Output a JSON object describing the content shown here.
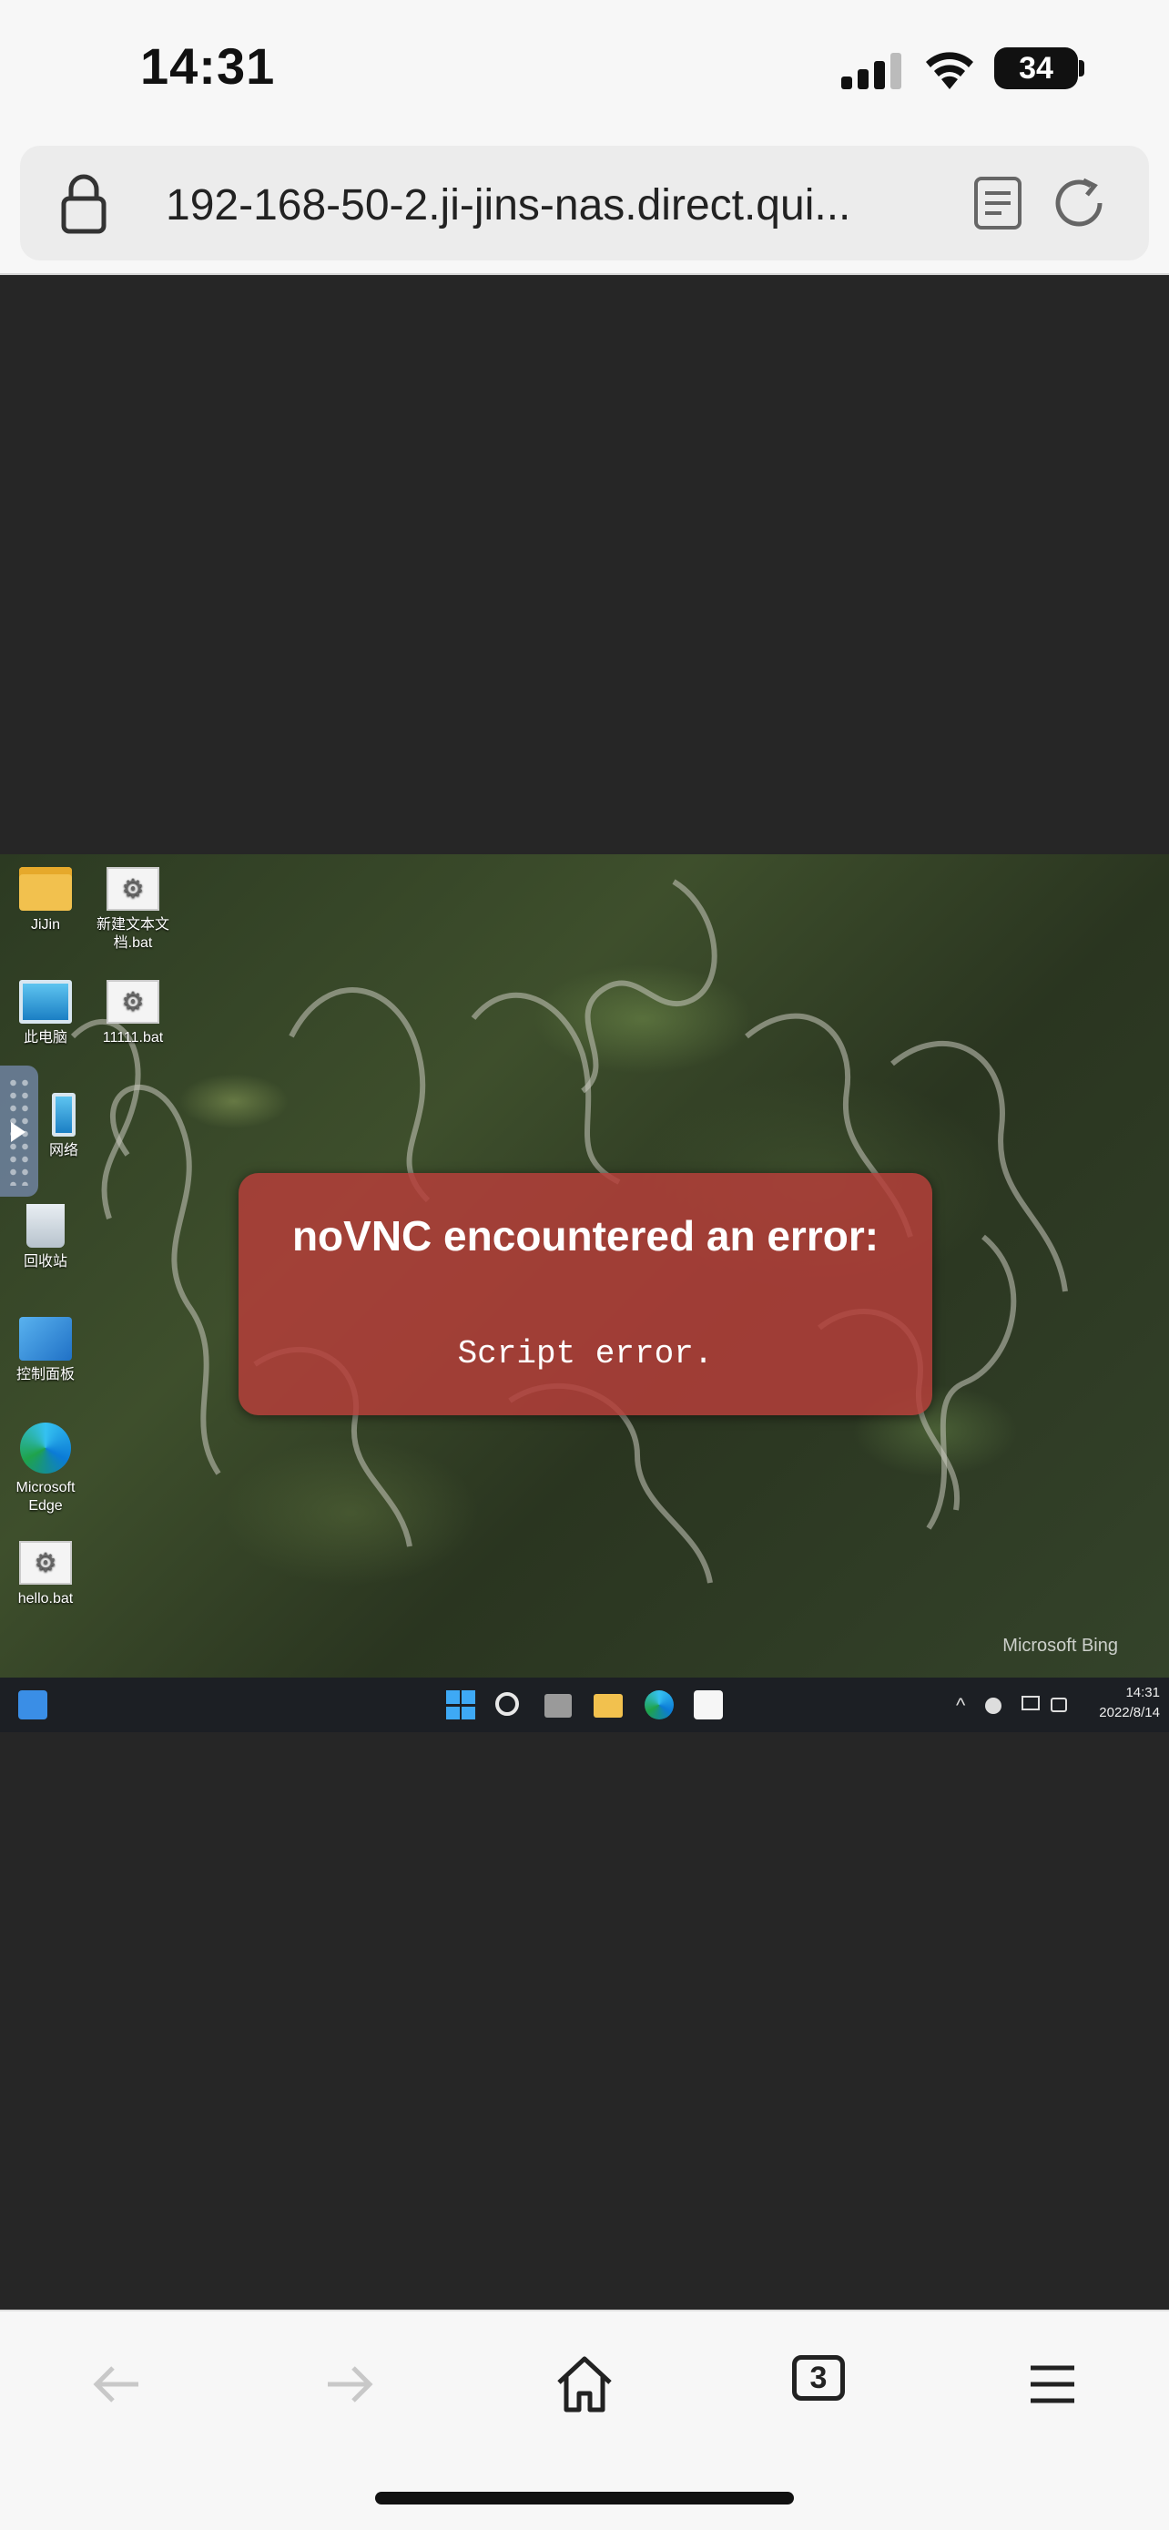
{
  "status_bar": {
    "time": "14:31",
    "battery": "34"
  },
  "browser": {
    "url": "192-168-50-2.ji-jins-nas.direct.qui...",
    "tabs_count": "3"
  },
  "desktop": {
    "icons": [
      {
        "label": "JiJin",
        "type": "folder"
      },
      {
        "label": "新建文本文档.bat",
        "type": "bat"
      },
      {
        "label": "此电脑",
        "type": "pc"
      },
      {
        "label": "11111.bat",
        "type": "bat"
      },
      {
        "label": "网络",
        "type": "network"
      },
      {
        "label": "回收站",
        "type": "bin"
      },
      {
        "label": "控制面板",
        "type": "control-panel"
      },
      {
        "label": "Microsoft Edge",
        "type": "edge"
      },
      {
        "label": "hello.bat",
        "type": "bat"
      }
    ],
    "watermark": "Microsoft Bing"
  },
  "error": {
    "title": "noVNC encountered an error:",
    "message": "Script error."
  },
  "taskbar": {
    "clock_time": "14:31",
    "clock_date": "2022/8/14",
    "tray_chevron": "^"
  },
  "colors": {
    "error_bg": "#b43e3a",
    "page_bg": "#262626",
    "chrome_bg": "#f7f7f7"
  }
}
